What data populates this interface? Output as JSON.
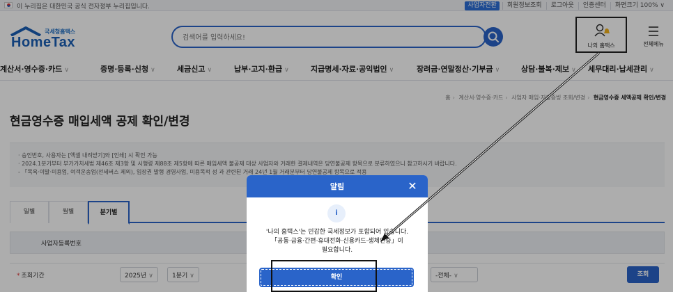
{
  "govbar": {
    "text": "이 누리집은 대한민국 공식 전자정부 누리집입니다.",
    "business_switch": "사업자전환",
    "links": [
      "회원정보조회",
      "로그아웃",
      "인증센터",
      "화면크기 100% ∨"
    ]
  },
  "header": {
    "logo_small": "국세청홈택스",
    "logo_big": "HomeTax",
    "search_placeholder": "검색어를 입력하세요!",
    "my_hometax": "나의 홈택스",
    "all_menu": "전체메뉴"
  },
  "nav": {
    "items": [
      "계산서·영수증·카드",
      "증명·등록·신청",
      "세금신고",
      "납부·고지·환급",
      "지급명세·자료·공익법인",
      "장려금·연말정산·기부금",
      "상담·불복·제보",
      "세무대리·납세관리"
    ]
  },
  "breadcrumb": {
    "items": [
      "홈",
      "계산서·영수증·카드",
      "사업자 매입·지출증빙 조회/변경",
      "현금영수증 세액공제 확인/변경"
    ]
  },
  "page": {
    "title": "현금영수증 매입세액 공제 확인/변경",
    "notices": [
      "· 승인번호, 사용자는 [엑셀 내려받기]와 [인쇄] 시 확인 가능",
      "· 2024.1분기부터 부가가치세법 제46조 제3항 및 시행령 제88조 제5항에 따른 매입세액 불공제 대상 사업자와 거래한 결제내역은 당연불공제 항목으로 분류하였으니 참고하시기 바랍니다.",
      "  - 「목욕·이발·미용업, 여객운송업(전세버스 제외), 입장권 발행 경영사업, 미용목적 성                                             과 관련된 거래 24년 1월 거래분부터 당연불공제 항목으로 적용"
    ],
    "tabs": [
      "일별",
      "월별",
      "분기별"
    ],
    "biz_label": "사업자등록번호",
    "period_label": "조회기간",
    "year": "2025년",
    "quarter": "1분기",
    "filter": "-전체-",
    "search_button": "조회"
  },
  "modal": {
    "title": "알림",
    "close": "✕",
    "info_icon": "i",
    "message_lines": [
      "'나의 홈택스'는 민감한 국세정보가 포함되어 있습니다.",
      "「공동·금융·간편·휴대전화·신용카드·생체인증」이",
      "필요합니다."
    ],
    "ok_button": "확인"
  },
  "colors": {
    "primary": "#2a64c9",
    "annotation": "#111111"
  }
}
